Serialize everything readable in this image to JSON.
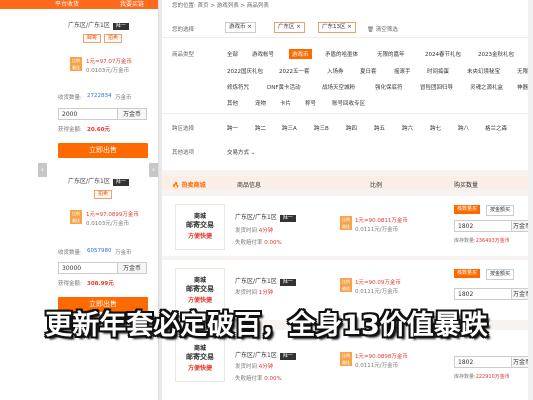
{
  "left_panel": {
    "header_left": "平台收货",
    "header_right": "我要买链",
    "cards": [
      {
        "title": "广东区/广东1区",
        "tag": "拜一",
        "pills": [
          "邮寄",
          "拍卖"
        ],
        "ratio_label": "比例\n最佳",
        "rate_line": "1元=97.07万金币",
        "rate_sub": "0.0103元/万金币",
        "stock_label": "收货数量:",
        "stock_value": "2722834",
        "stock_unit": "万金币",
        "input_value": "2000",
        "input_unit": "万金币",
        "earn_label": "获得金额:",
        "earn_value": "20.60元",
        "sell_label": "立即出售"
      },
      {
        "title": "广东区/广东1区",
        "tag": "拜一",
        "pills": [
          "拍卖"
        ],
        "ratio_label": "比例\n最佳",
        "rate_line": "1元=97.0899万金币",
        "rate_sub": "0.0103元/万金币",
        "stock_label": "收货数量:",
        "stock_value": "6057980",
        "stock_unit": "万金币",
        "input_value": "30000",
        "input_unit": "万金币",
        "earn_label": "获得金额:",
        "earn_value": "308.99元",
        "sell_label": "立即出售"
      }
    ],
    "arrow_left": "‹",
    "arrow_right": "›"
  },
  "right_panel": {
    "breadcrumb": [
      "您的位置:",
      "首页",
      ">",
      "游戏列表",
      ">",
      "商品列表"
    ],
    "filter_chips_label": "您的选择",
    "filter_chips": [
      "游戏币 ×",
      "广东区 ×",
      "广东13区 ×"
    ],
    "clear_label": "清空筛选",
    "type_row": {
      "label": "商品类型",
      "row1": [
        "全部",
        "游戏帐号",
        "游戏币",
        "矛盾的哈墨体",
        "无限的嘉年",
        "2024春节礼包",
        "2023金秋礼包"
      ],
      "row2": [
        "2022国庆礼包",
        "2022五一套",
        "入场券",
        "夏日套",
        "摇滚手",
        "时间捣蛋",
        "未央幻境秘宝",
        "无限"
      ],
      "row3": [
        "修炼符咒",
        "DNF黄卡活动",
        "战场天空城粉",
        "强化保底符",
        "冒险团回归导",
        "灵魂之源礼盒",
        "神器"
      ],
      "row4": [
        "其他",
        "宠物",
        "卡片",
        "称号",
        "账号回收专区"
      ],
      "active": "游戏币"
    },
    "server_row": {
      "label": "跨区选择",
      "items": [
        "跨一",
        "跨二",
        "跨三A",
        "跨三B",
        "跨四",
        "跨五",
        "跨六",
        "跨七",
        "跨八",
        "格兰之森"
      ]
    },
    "other_row": {
      "label": "其他选项",
      "item": "交易方式 ⌄"
    },
    "table_header": {
      "section": "热卖商城",
      "col_info": "商品信息",
      "col_ratio": "比例",
      "col_qty": "购买数量"
    },
    "listings": [
      {
        "thumb": [
          "商城",
          "邮寄交易",
          "方便快捷"
        ],
        "server": "广东区/广东1区",
        "tag": "拜一",
        "delivery": "发货时间",
        "delivery_value": "4分钟",
        "fail_label": "失败赔付率",
        "fail_value": "0.00%",
        "ratio_label": "比例\n最佳",
        "rate_line": "1元=90.0811万金币",
        "rate_sub": "0.0111元/万金币",
        "tab_active": "核数量买",
        "tab_other": "按金额买",
        "qty": "1802",
        "unit": "万金币",
        "stock_label": "库存数量:",
        "stock_value": "236493万金币"
      },
      {
        "thumb": [
          "商城",
          "邮寄交易",
          "方便快捷"
        ],
        "server": "广东区/广东1区",
        "tag": "拜一",
        "delivery": "发货时间",
        "delivery_value": "1分钟",
        "fail_label": "失败赔付率",
        "fail_value": "0.00%",
        "ratio_label": "比例\n最佳",
        "rate_line": "1元=90.09万金币",
        "rate_sub": "0.0111元/万金币",
        "tab_active": "核数量买",
        "tab_other": "按金额买",
        "qty": "1802",
        "unit": "万金币",
        "stock_label": "库存数量:",
        "stock_value": ""
      },
      {
        "thumb": [
          "商城",
          "邮寄交易",
          "方便快捷"
        ],
        "server": "广东区/广东1区",
        "tag": "拜一",
        "delivery": "发货时间",
        "delivery_value": "4分钟",
        "fail_label": "失败赔付率",
        "fail_value": "0.00%",
        "ratio_label": "比例\n最佳",
        "rate_line": "1元=90.0898万金币",
        "rate_sub": "0.0111元/万金币",
        "tab_active": "",
        "tab_other": "",
        "qty": "1802",
        "unit": "万金币",
        "stock_label": "库存数量:",
        "stock_value": "222910万金币"
      }
    ]
  },
  "caption": "更新年套必定破百，全身13价值暴跌",
  "colors": {
    "accent": "#ff6a00",
    "price_red": "#e5372c",
    "ratio_badge": "#f7a34a"
  }
}
